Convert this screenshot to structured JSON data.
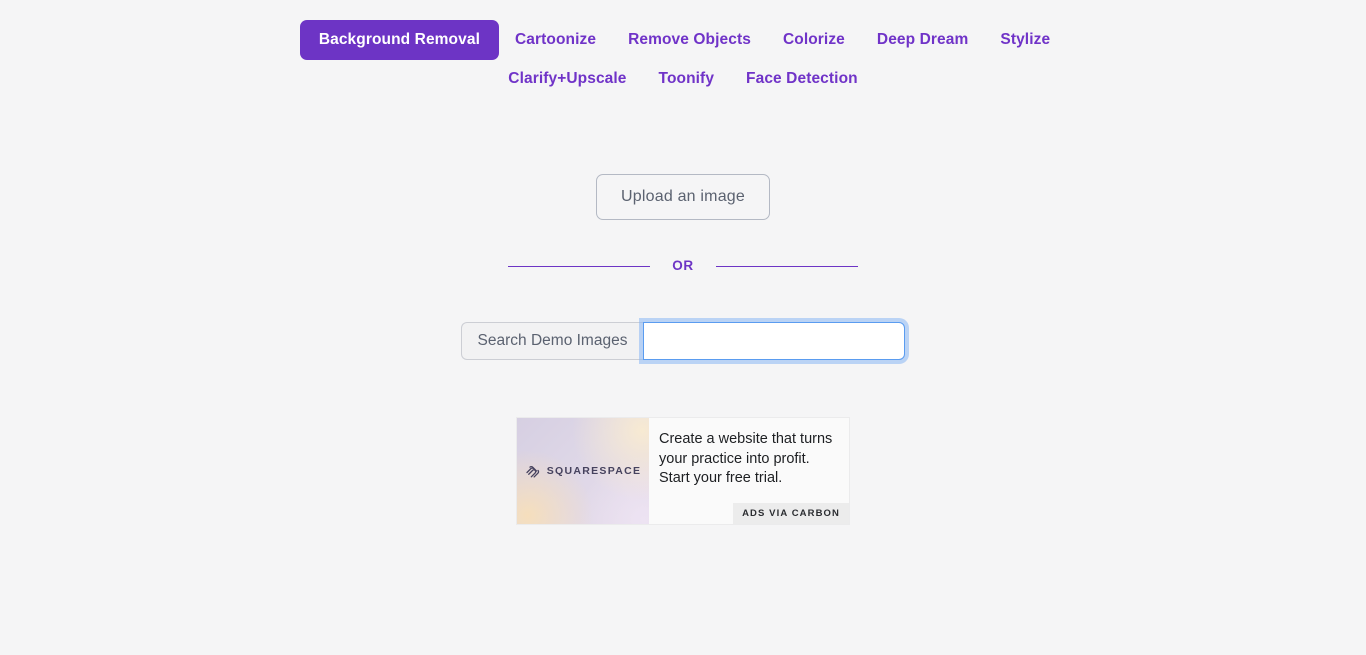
{
  "nav": {
    "row1": [
      {
        "label": "Background Removal",
        "active": true
      },
      {
        "label": "Cartoonize",
        "active": false
      },
      {
        "label": "Remove Objects",
        "active": false
      },
      {
        "label": "Colorize",
        "active": false
      },
      {
        "label": "Deep Dream",
        "active": false
      },
      {
        "label": "Stylize",
        "active": false
      }
    ],
    "row2": [
      {
        "label": "Clarify+Upscale",
        "active": false
      },
      {
        "label": "Toonify",
        "active": false
      },
      {
        "label": "Face Detection",
        "active": false
      }
    ]
  },
  "upload": {
    "label": "Upload an image"
  },
  "divider": {
    "text": "OR"
  },
  "search": {
    "label": "Search Demo Images",
    "value": "",
    "placeholder": ""
  },
  "ad": {
    "brand": "SQUARESPACE",
    "text": "Create a website that turns your practice into profit. Start your free trial.",
    "badge": "ADS VIA CARBON"
  },
  "colors": {
    "accent": "#6d34c5",
    "nav_link": "#7033c8",
    "page_bg": "#f5f5f6",
    "focus_ring": "#89b7f4",
    "focus_border": "#5a9cf0",
    "upload_text": "#5b6270"
  }
}
